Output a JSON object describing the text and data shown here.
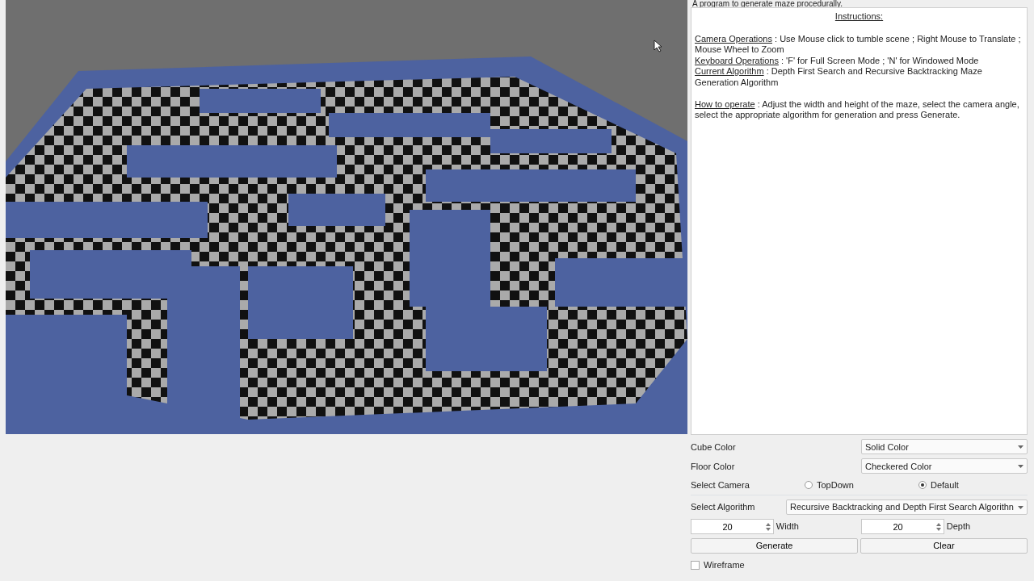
{
  "description": "A program to generate maze procedurally.",
  "instructions": {
    "title": "Instructions:",
    "sections": [
      {
        "items": [
          {
            "heading": "Camera Operations",
            "text": " : Use Mouse click to tumble scene ; Right Mouse to Translate ; Mouse Wheel to Zoom"
          },
          {
            "heading": "Keyboard Operations",
            "text": " : 'F' for Full Screen Mode ; 'N' for Windowed Mode"
          },
          {
            "heading": "Current Algorithm",
            "text": " : Depth First Search and Recursive Backtracking Maze Generation Algorithm"
          }
        ]
      },
      {
        "items": [
          {
            "heading": "How to operate",
            "text": " : Adjust the width and height of the maze, select the camera angle, select the appropriate algorithm for generation and press Generate."
          }
        ]
      }
    ]
  },
  "cube_color": {
    "label": "Cube Color",
    "value": "Solid Color"
  },
  "floor_color": {
    "label": "Floor Color",
    "value": "Checkered Color"
  },
  "camera": {
    "label": "Select Camera",
    "options": [
      {
        "label": "TopDown",
        "selected": false
      },
      {
        "label": "Default",
        "selected": true
      }
    ]
  },
  "algorithm": {
    "label": "Select Algorithm",
    "value": "Recursive Backtracking and Depth First Search Algorithn"
  },
  "width": {
    "value": "20",
    "label": "Width"
  },
  "depth": {
    "value": "20",
    "label": "Depth"
  },
  "buttons": [
    "Generate",
    "Clear"
  ],
  "wireframe": {
    "label": "Wireframe",
    "checked": false
  }
}
